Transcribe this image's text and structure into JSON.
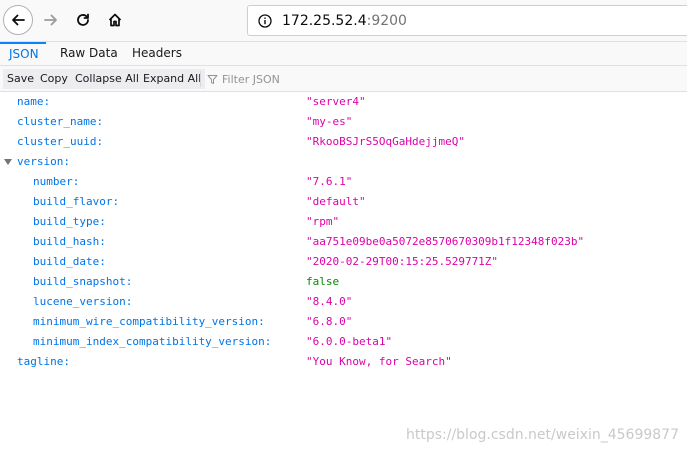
{
  "nav": {
    "url_host": "172.25.52.4",
    "url_port": ":9200"
  },
  "tabs": [
    "JSON",
    "Raw Data",
    "Headers"
  ],
  "toolbar": {
    "save": "Save",
    "copy": "Copy",
    "collapse_all": "Collapse All",
    "expand_all": "Expand All",
    "filter_placeholder": "Filter JSON"
  },
  "json": {
    "name": {
      "key": "name:",
      "value": "\"server4\""
    },
    "cluster_name": {
      "key": "cluster_name:",
      "value": "\"my-es\""
    },
    "cluster_uuid": {
      "key": "cluster_uuid:",
      "value": "\"RkooBSJrS5OqGaHdejjmeQ\""
    },
    "version": {
      "key": "version:"
    },
    "number": {
      "key": "number:",
      "value": "\"7.6.1\""
    },
    "build_flavor": {
      "key": "build_flavor:",
      "value": "\"default\""
    },
    "build_type": {
      "key": "build_type:",
      "value": "\"rpm\""
    },
    "build_hash": {
      "key": "build_hash:",
      "value": "\"aa751e09be0a5072e8570670309b1f12348f023b\""
    },
    "build_date": {
      "key": "build_date:",
      "value": "\"2020-02-29T00:15:25.529771Z\""
    },
    "build_snapshot": {
      "key": "build_snapshot:",
      "value": "false"
    },
    "lucene_version": {
      "key": "lucene_version:",
      "value": "\"8.4.0\""
    },
    "minimum_wire_compatibility_version": {
      "key": "minimum_wire_compatibility_version:",
      "value": "\"6.8.0\""
    },
    "minimum_index_compatibility_version": {
      "key": "minimum_index_compatibility_version:",
      "value": "\"6.0.0-beta1\""
    },
    "tagline": {
      "key": "tagline:",
      "value": "\"You Know, for Search\""
    }
  },
  "watermark": "https://blog.csdn.net/weixin_45699877",
  "colors": {
    "key": "#0074e8",
    "string": "#dd00a9",
    "boolean": "#058b00",
    "active_tab": "#0a84ff"
  }
}
